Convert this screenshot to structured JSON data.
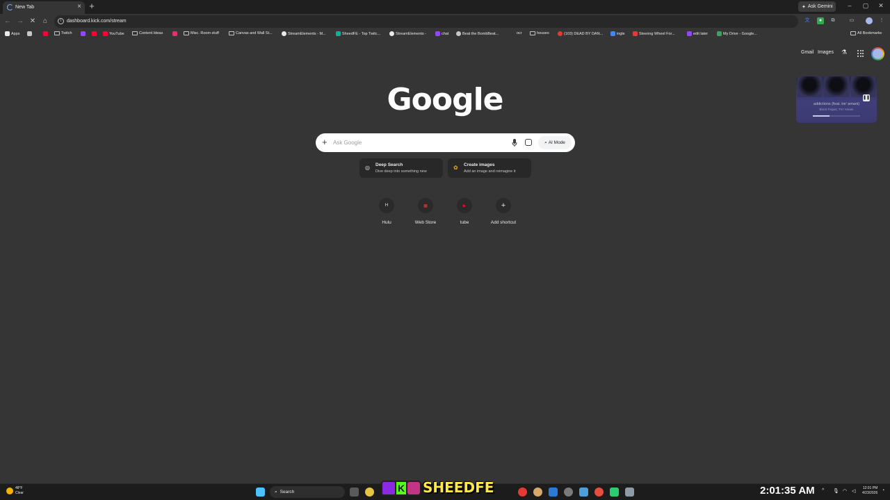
{
  "browser": {
    "tab_title": "New Tab",
    "tab_close": "×",
    "new_tab": "+",
    "ask_gemini": "Ask Gemini",
    "window_controls": [
      "–",
      "▢",
      "✕"
    ],
    "url": "dashboard.kick.com/stream"
  },
  "bookmarks": {
    "items": [
      {
        "label": "Apps",
        "icon": "apps-grid-icon",
        "color": "#e8eaed"
      },
      {
        "label": "",
        "icon": "tab-groups-icon",
        "color": "#e8eaed"
      },
      {
        "label": "",
        "icon": "youtube-icon",
        "color": "#ff0033"
      },
      {
        "label": "Twitch",
        "icon": "folder-icon",
        "color": "#e8eaed"
      },
      {
        "label": "",
        "icon": "twitch-icon",
        "color": "#9146ff"
      },
      {
        "label": "",
        "icon": "youtube-icon",
        "color": "#ff0033"
      },
      {
        "label": "YouTube",
        "icon": "youtube-icon",
        "color": "#ff0033"
      },
      {
        "label": "Content Ideas",
        "icon": "folder-icon",
        "color": "#e8eaed"
      },
      {
        "label": "",
        "icon": "instagram-icon",
        "color": "#e1306c"
      },
      {
        "label": "Misc. Room stuff",
        "icon": "folder-icon",
        "color": "#e8eaed"
      },
      {
        "label": "Canvas and Wall St...",
        "icon": "folder-icon",
        "color": "#e8eaed"
      },
      {
        "label": "StreamElements - M...",
        "icon": "streamelements-icon",
        "color": "#e8eaed"
      },
      {
        "label": "SheedFE - Top Twitc...",
        "icon": "tt-icon",
        "color": "#00b894"
      },
      {
        "label": "StreamElements -",
        "icon": "streamelements-icon",
        "color": "#e8eaed"
      },
      {
        "label": "chat",
        "icon": "twitch-icon",
        "color": "#9146ff"
      },
      {
        "label": "Beat the BombBeat...",
        "icon": "globe-icon",
        "color": "#e8eaed"
      },
      {
        "label": "ocr",
        "icon": "blank-icon",
        "color": "#353535"
      },
      {
        "label": "houses",
        "icon": "folder-icon",
        "color": "#e8eaed"
      },
      {
        "label": "(103) DEAD BY DAN...",
        "icon": "dbd-icon",
        "color": "#e53935"
      },
      {
        "label": "ingle",
        "icon": "translate-icon",
        "color": "#4285f4"
      },
      {
        "label": "Steering Wheel For...",
        "icon": "shop-icon",
        "color": "#e53935"
      },
      {
        "label": "edit later",
        "icon": "twitch-icon",
        "color": "#9146ff"
      },
      {
        "label": "My Drive - Google...",
        "icon": "drive-icon",
        "color": "#34a853"
      }
    ],
    "all_bookmarks": "All Bookmarks"
  },
  "google": {
    "logo": "Google",
    "gmail": "Gmail",
    "images": "Images",
    "search_placeholder": "Ask Google",
    "search_value": "",
    "ai_mode": "AI Mode",
    "chips": [
      {
        "title": "Deep Search",
        "subtitle": "Dive deep into something new",
        "icon": "deep-search-icon"
      },
      {
        "title": "Create images",
        "subtitle": "Add an image and reimagine it",
        "icon": "banana-icon"
      }
    ],
    "shortcuts": [
      {
        "label": "Hulu",
        "glyph": "H",
        "color": "#e8eaed"
      },
      {
        "label": "Web Store",
        "glyph": "▦",
        "color": "#ea4335"
      },
      {
        "label": "tube",
        "glyph": "▶",
        "color": "#ff0033"
      },
      {
        "label": "Add shortcut",
        "glyph": "+",
        "color": "#e8eaed"
      }
    ]
  },
  "media_player": {
    "track": "addictions (feat. tre' amani)",
    "artist": "Brent Faiyaz, Tre' Amani",
    "progress": 0.35
  },
  "taskbar": {
    "temperature": "48°F",
    "condition": "Clear",
    "search_label": "Search",
    "streamer_name": "SHEEDFE",
    "big_clock": "2:01:35 AM",
    "time": "12:01 PM",
    "date": "4/23/2026"
  }
}
